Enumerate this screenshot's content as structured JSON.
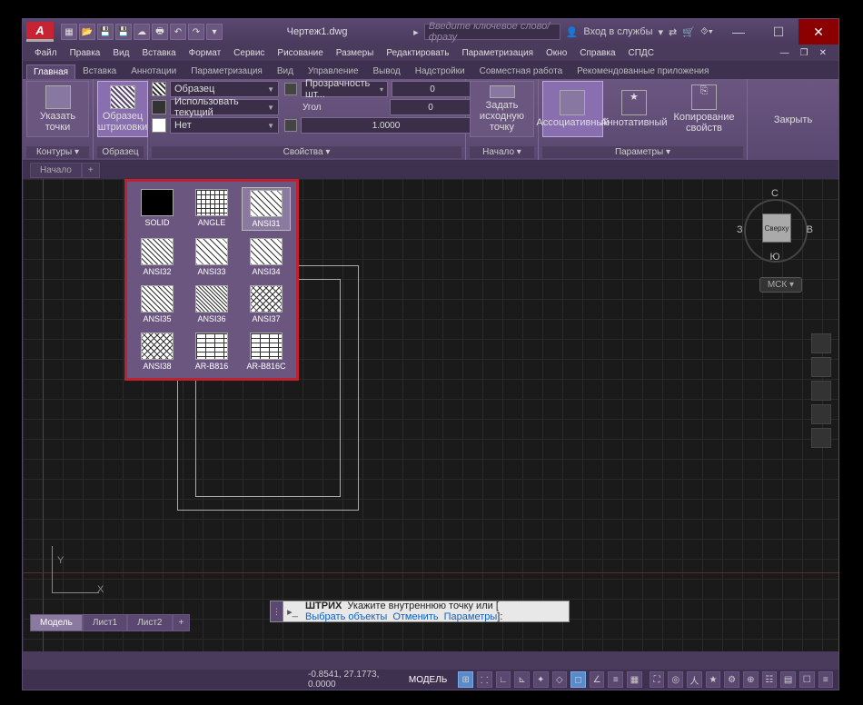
{
  "title": "Чертеж1.dwg",
  "app_letter": "A",
  "search_placeholder": "Введите ключевое слово/фразу",
  "login_label": "Вход в службы",
  "menu": [
    "Файл",
    "Правка",
    "Вид",
    "Вставка",
    "Формат",
    "Сервис",
    "Рисование",
    "Размеры",
    "Редактировать",
    "Параметризация",
    "Окно",
    "Справка",
    "СПДС"
  ],
  "ribbon_tabs": [
    "Главная",
    "Вставка",
    "Аннотации",
    "Параметризация",
    "Вид",
    "Управление",
    "Вывод",
    "Надстройки",
    "Совместная работа",
    "Рекомендованные приложения"
  ],
  "active_ribbon_tab": 0,
  "panels": {
    "boundaries": {
      "title": "Контуры ▾",
      "btn": "Указать точки"
    },
    "pattern": {
      "title": "Образец",
      "btn": "Образец штриховки"
    },
    "properties": {
      "title": "Свойства ▾",
      "type_label": "Образец",
      "color_label": "Использовать текущий",
      "bg_label": "Нет",
      "transp_label": "Прозрачность шт...",
      "transp_val": "0",
      "angle_label": "Угол",
      "angle_val": "0",
      "scale_val": "1.0000"
    },
    "origin": {
      "title": "Начало ▾",
      "btn": "Задать исходную точку"
    },
    "options": {
      "title": "Параметры ▾",
      "assoc": "Ассоциативный",
      "annot": "Аннотативный",
      "match": "Копирование свойств"
    },
    "close": {
      "label": "Закрыть"
    }
  },
  "patterns": [
    "SOLID",
    "ANGLE",
    "ANSI31",
    "ANSI32",
    "ANSI33",
    "ANSI34",
    "ANSI35",
    "ANSI36",
    "ANSI37",
    "ANSI38",
    "AR-B816",
    "AR-B816C"
  ],
  "selected_pattern": 2,
  "doc_tab": "Начало",
  "viewcube": {
    "n": "С",
    "s": "Ю",
    "w": "З",
    "e": "В",
    "face": "Сверху",
    "wcs": "МСК ▾"
  },
  "ucs": {
    "x": "X",
    "y": "Y"
  },
  "cmd": {
    "name": "ШТРИХ",
    "prompt": "Укажите внутреннюю точку или [",
    "opts": [
      "Выбрать объекты",
      "Отменить",
      "Параметры"
    ],
    "end": "]:"
  },
  "layout_tabs": [
    "Модель",
    "Лист1",
    "Лист2"
  ],
  "status": {
    "coords": "-0.8541, 27.1773, 0.0000",
    "model": "МОДЕЛЬ"
  }
}
